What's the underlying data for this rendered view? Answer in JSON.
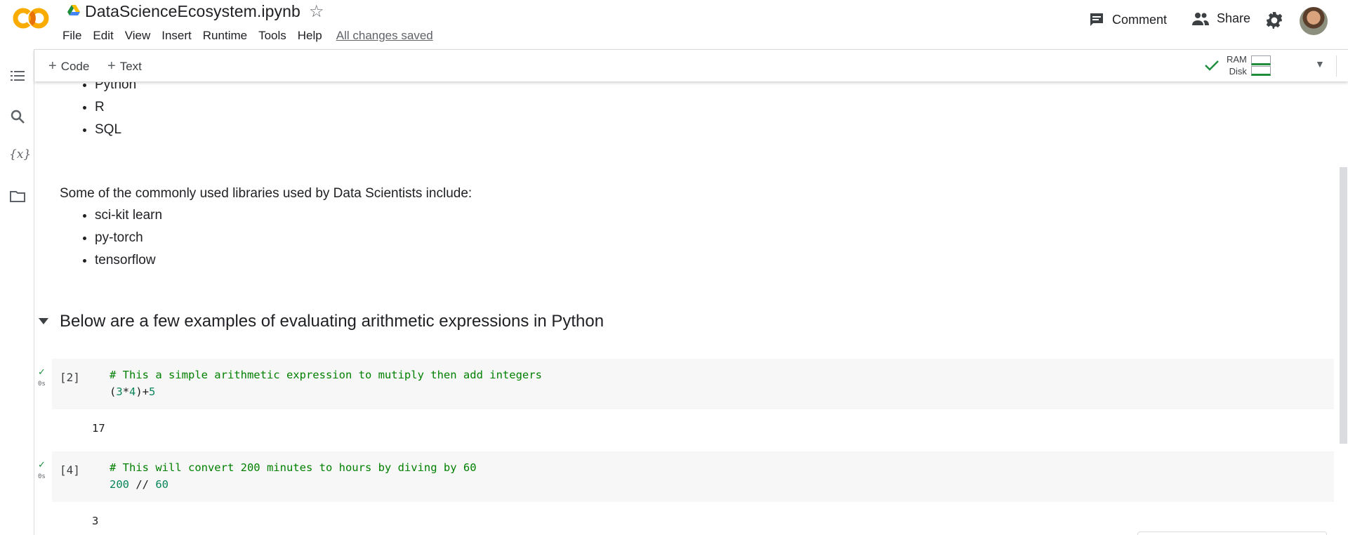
{
  "header": {
    "logo_text": "CO",
    "title": "DataScienceEcosystem.ipynb",
    "menu": [
      "File",
      "Edit",
      "View",
      "Insert",
      "Runtime",
      "Tools",
      "Help"
    ],
    "save_status": "All changes saved",
    "comment_label": "Comment",
    "share_label": "Share"
  },
  "toolbar": {
    "add_code": "Code",
    "add_text": "Text",
    "ram_label": "RAM",
    "disk_label": "Disk"
  },
  "notebook": {
    "languages": [
      "Python",
      "R",
      "SQL"
    ],
    "libraries_intro": "Some of the commonly used libraries used by Data Scientists include:",
    "libraries": [
      "sci-kit learn",
      "py-torch",
      "tensorflow"
    ],
    "section_heading": "Below are a few examples of evaluating arithmetic expressions in Python",
    "cells": [
      {
        "exec_count": "[2]",
        "run_time": "0s",
        "comment": "# This a simple arithmetic expression to mutiply then add integers",
        "code_parts": [
          "(",
          "3",
          "*",
          "4",
          ")+",
          "5"
        ],
        "output": "17"
      },
      {
        "exec_count": "[4]",
        "run_time": "0s",
        "comment": "# This will convert 200 minutes to hours by diving by 60",
        "code_parts": [
          "200",
          " // ",
          "60"
        ],
        "output": "3"
      }
    ]
  },
  "colors": {
    "accent_orange": "#F9AB00",
    "code_comment": "#008000",
    "code_number": "#098658",
    "success": "#1E8E3E"
  }
}
